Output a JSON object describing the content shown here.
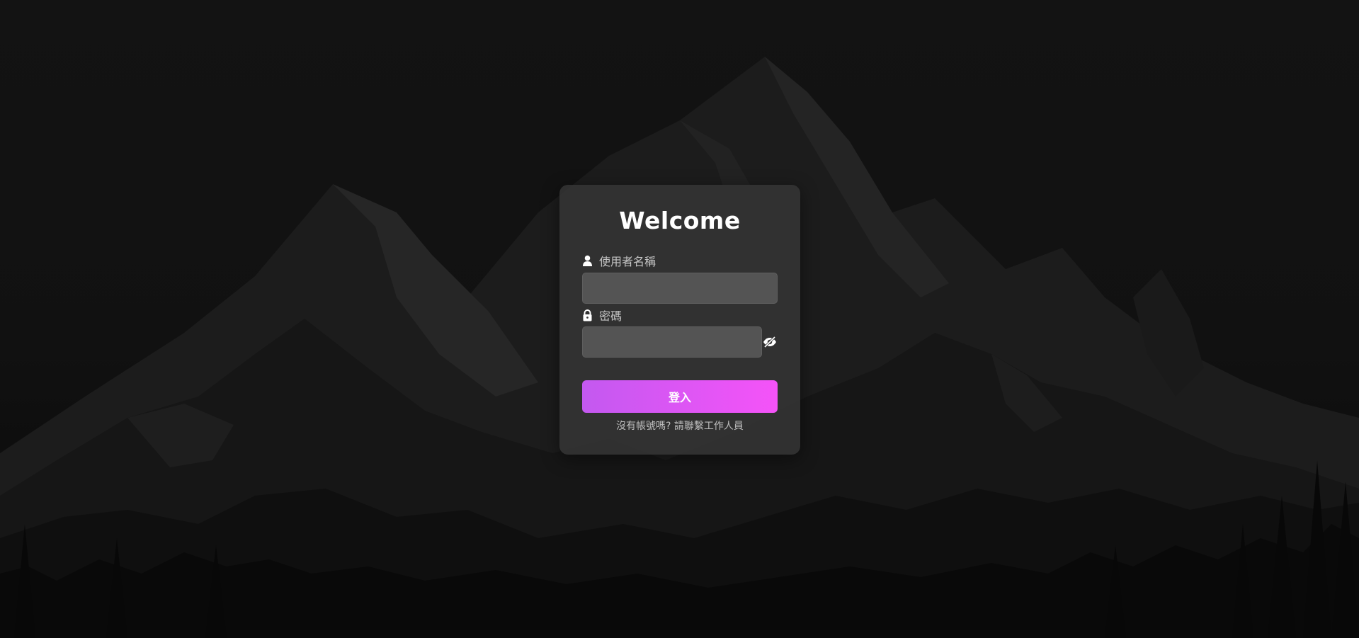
{
  "login": {
    "title": "Welcome",
    "username_label": "使用者名稱",
    "username_value": "",
    "password_label": "密碼",
    "password_value": "",
    "submit_label": "登入",
    "footer_note": "沒有帳號嗎? 請聯繫工作人員"
  },
  "icons": {
    "username": "user-icon",
    "password": "lock-icon",
    "toggle_visibility": "eye-slash-icon"
  },
  "colors": {
    "background": "#111111",
    "card": "#343434",
    "input": "#545454",
    "button_gradient_start": "#c359f0",
    "button_gradient_end": "#f553f8",
    "title": "#ffffff",
    "label": "#c4c4c4"
  }
}
